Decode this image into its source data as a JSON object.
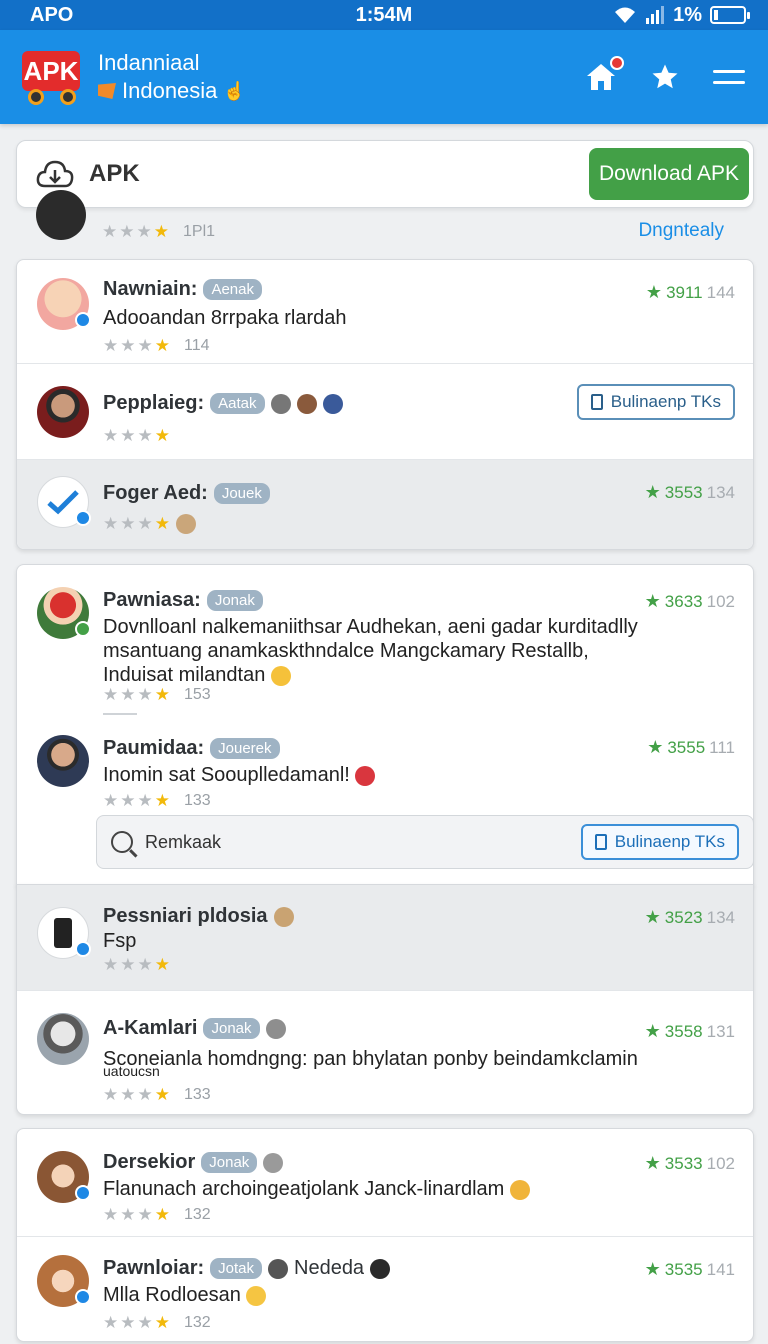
{
  "status": {
    "carrier": "APO",
    "time": "1:54M",
    "battery": "1%",
    "battery_level": 0.15
  },
  "header": {
    "logo_text": "APK",
    "title": "Indanniaal",
    "subtitle": "Indonesia"
  },
  "apk_bar": {
    "label": "APK",
    "download_label": "Download APK"
  },
  "peek": {
    "count": "1Pl1",
    "link": "Dngntealy"
  },
  "card1": {
    "rows": [
      {
        "name": "Nawniain:",
        "chip": "Aenak",
        "text": "Adooandan 8rrpaka rlardah",
        "count": "114",
        "score": "3911",
        "score_sub": "144"
      },
      {
        "name": "Pepplaieg:",
        "chip": "Aatak",
        "button": "Bulinaenp TKs"
      },
      {
        "name": "Foger Aed:",
        "chip": "Jouek",
        "score": "3553",
        "score_sub": "134"
      }
    ]
  },
  "card2": {
    "rows": [
      {
        "name": "Pawniasa:",
        "chip": "Jonak",
        "text": "Dovnlloanl nalkemaniithsar Audhekan, aeni gadar kurditadlly msantuang anamkaskthndalce Mangckamary Restallb, Induisat milandtan",
        "count": "153",
        "score": "3633",
        "score_sub": "102"
      },
      {
        "name": "Paumidaa:",
        "chip": "Jouerek",
        "text": "Inomin sat Soouplledamanl!",
        "count": "133",
        "score": "3555",
        "score_sub": "111"
      }
    ],
    "search": {
      "placeholder": "Remkaak",
      "button": "Bulinaenp TKs"
    }
  },
  "card3": {
    "rows": [
      {
        "name": "Pessniari pldosia",
        "text": "Fsp",
        "score": "3523",
        "score_sub": "134"
      },
      {
        "name": "A-Kamlari",
        "chip": "Jonak",
        "text": "Sconeianla homdngng: pan bhylatan ponby beindamkclamin",
        "text2": "uatoucsn",
        "count": "133",
        "score": "3558",
        "score_sub": "131"
      }
    ]
  },
  "card4": {
    "rows": [
      {
        "name": "Dersekior",
        "chip": "Jonak",
        "text": "Flanunach archoingeatjolank Janck-linardlam",
        "count": "132",
        "score": "3533",
        "score_sub": "102"
      },
      {
        "name": "Pawnloiar:",
        "chip": "Jotak",
        "extra": "Nededa",
        "text": "Mlla Rodloesan",
        "count": "132",
        "score": "3535",
        "score_sub": "141"
      }
    ]
  },
  "colors": {
    "primary": "#1a8ee6",
    "download": "#43a047",
    "score": "#43a047",
    "star": "#f2b90b"
  },
  "icons": [
    "signal-icon",
    "wifi-icon",
    "battery-icon",
    "home-icon",
    "star-icon",
    "menu-icon",
    "cloud-icon",
    "search-icon",
    "document-icon",
    "verified-badge-icon"
  ]
}
